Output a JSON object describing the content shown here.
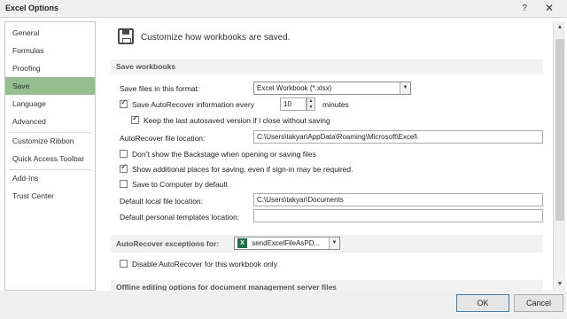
{
  "window": {
    "title": "Excel Options",
    "help_glyph": "?",
    "close_glyph": "✕"
  },
  "sidebar": {
    "items": [
      {
        "label": "General"
      },
      {
        "label": "Formulas"
      },
      {
        "label": "Proofing"
      },
      {
        "label": "Save"
      },
      {
        "label": "Language"
      },
      {
        "label": "Advanced"
      },
      {
        "label": "Customize Ribbon"
      },
      {
        "label": "Quick Access Toolbar"
      },
      {
        "label": "Add-Ins"
      },
      {
        "label": "Trust Center"
      }
    ],
    "active": "Save",
    "active_color": "#95bf8e"
  },
  "header": {
    "text": "Customize how workbooks are saved."
  },
  "save_workbooks": {
    "title": "Save workbooks",
    "format_label": "Save files in this format:",
    "format_value": "Excel Workbook (*.xlsx)",
    "autorecover_label": "Save AutoRecover information every",
    "autorecover_checked": true,
    "autorecover_minutes": "10",
    "minutes_label": "minutes",
    "keep_last_label": "Keep the last autosaved version if I close without saving",
    "keep_last_checked": true,
    "ar_location_label": "AutoRecover file location:",
    "ar_location_value": "C:\\Users\\takyar\\AppData\\Roaming\\Microsoft\\Excel\\",
    "dont_show_backstage_label": "Don’t show the Backstage when opening or saving files",
    "dont_show_backstage_checked": false,
    "show_additional_label": "Show additional places for saving, even if sign-in may be required.",
    "show_additional_checked": true,
    "save_to_computer_label": "Save to Computer by default",
    "save_to_computer_checked": false,
    "default_local_label": "Default local file location:",
    "default_local_value": "C:\\Users\\takyar\\Documents",
    "personal_templates_label": "Default personal templates location:",
    "personal_templates_value": ""
  },
  "autorecover_exceptions": {
    "title": "AutoRecover exceptions for:",
    "workbook": "sendExcelFileAsPD...",
    "disable_label": "Disable AutoRecover for this workbook only",
    "disable_checked": false
  },
  "offline": {
    "title": "Offline editing options for document management server files"
  },
  "footer": {
    "ok_label": "OK",
    "cancel_label": "Cancel"
  },
  "icons": {
    "arrow_down": "▼",
    "arrow_up": "▲",
    "excel_letter": "X"
  }
}
